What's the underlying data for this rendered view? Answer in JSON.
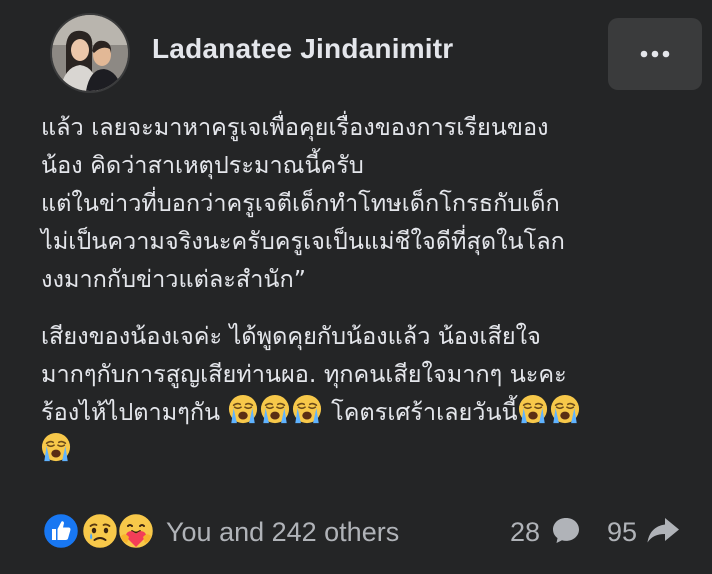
{
  "post": {
    "author": "Ladanatee Jindanimitr",
    "paragraph1": [
      "แล้ว เลยจะมาหาครูเจเพื่อคุยเรื่องของการเรียนของ",
      "น้อง คิดว่าสาเหตุประมาณนี้ครับ",
      "แต่ในข่าวที่บอกว่าครูเจตีเด็กทำโทษเด็กโกรธกับเด็ก",
      "ไม่เป็นความจริงนะครับครูเจเป็นแม่ชีใจดีที่สุดในโลก",
      "งงมากกับข่าวแต่ละสำนัก”"
    ],
    "paragraph2": {
      "line1": "เสียงของน้องเจค่ะ ได้พูดคุยกับน้องแล้ว น้องเสียใจ",
      "line2": "มากๆกับการสูญเสียท่านผอ. ทุกคนเสียใจมากๆ นะคะ",
      "line3_part1": "ร้องไห้ไปตามๆกัน",
      "line3_part2": "โคตรเศร้าเลยวันนี้"
    },
    "emoji_icon": "loudly-crying-face-icon"
  },
  "footer": {
    "reactions_text": "You and 242 others",
    "reaction_icons": [
      "like-icon",
      "sad-icon",
      "care-icon"
    ],
    "comment_count": "28",
    "share_count": "95"
  },
  "colors": {
    "background": "#242526",
    "text": "#e4e6eb",
    "secondary_text": "#b0b3b8",
    "button": "#3a3b3c",
    "like_blue": "#1877f2",
    "emoji_yellow": "#f7c84a"
  }
}
